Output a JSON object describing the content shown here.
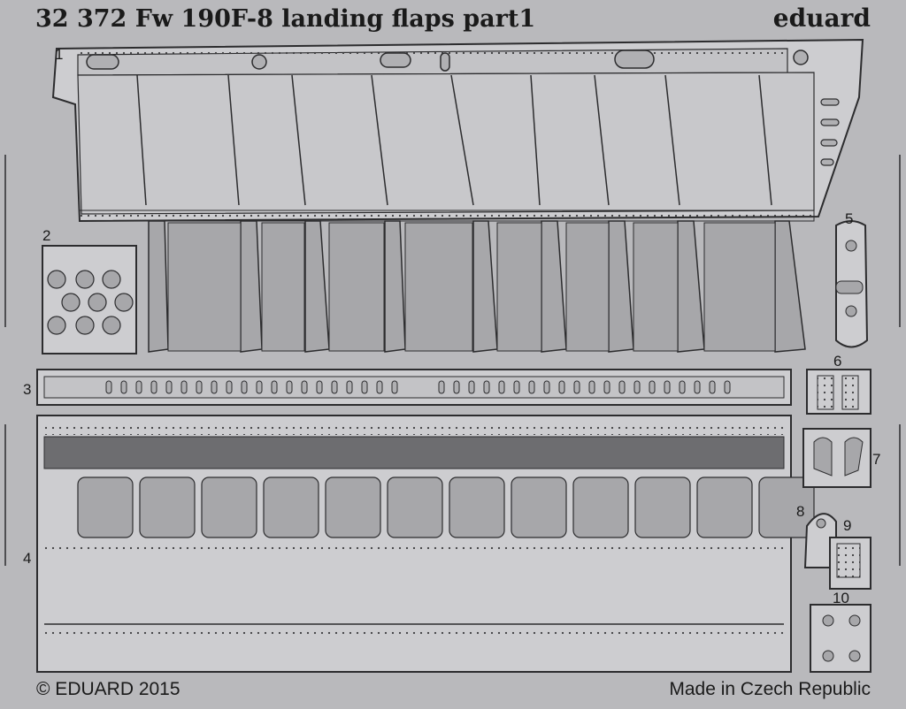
{
  "header": {
    "title": "32 372  Fw 190F-8 landing flaps   part1",
    "brand": "eduard"
  },
  "footer": {
    "copyright": "© EDUARD 2015",
    "origin": "Made in Czech Republic"
  },
  "part_numbers": [
    "1",
    "2",
    "3",
    "4",
    "5",
    "6",
    "7",
    "8",
    "9",
    "10"
  ],
  "colors": {
    "fret_background": "#b9b9bc",
    "part_face": "#cdcdd0",
    "etched_face": "#a7a7aa",
    "outline": "#2c2c2e"
  }
}
